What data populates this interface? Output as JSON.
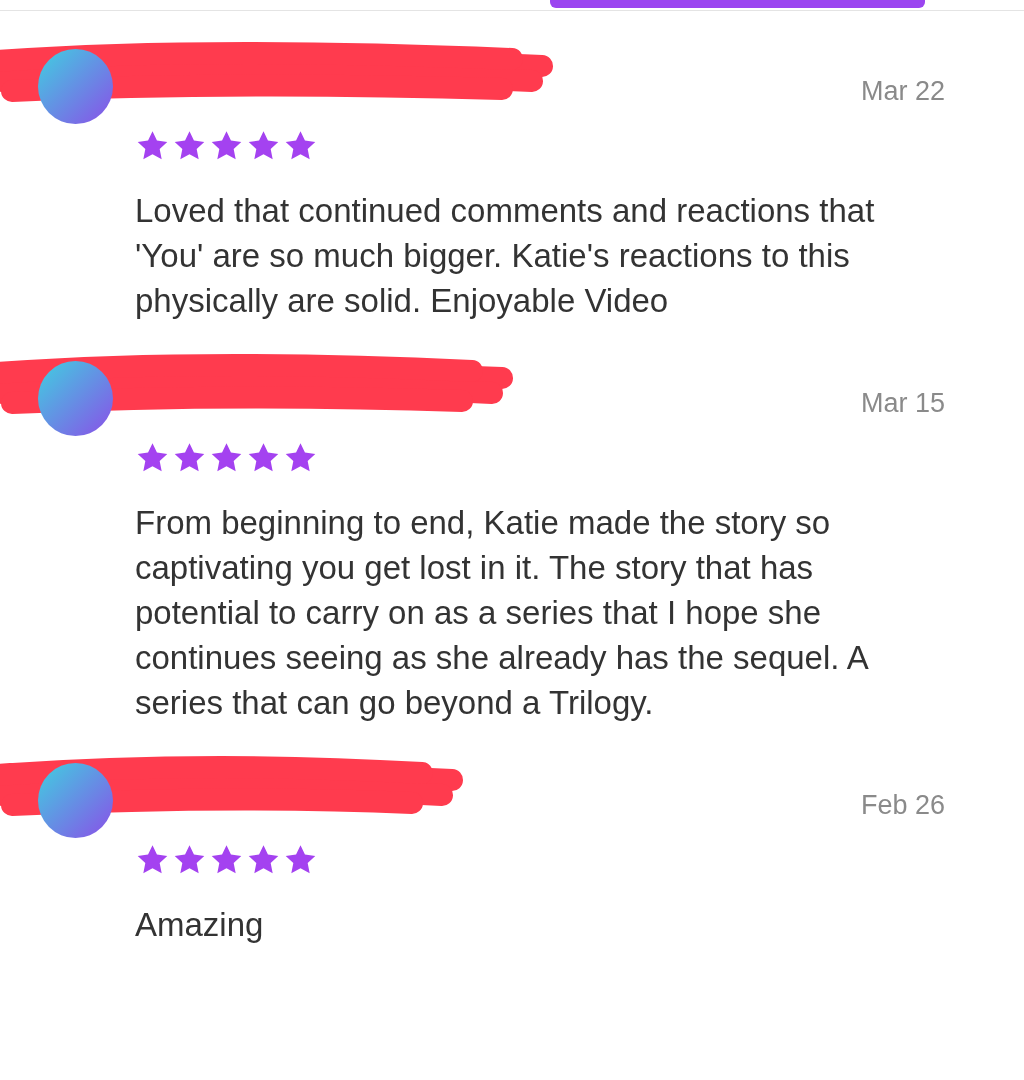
{
  "tab_indicator": {
    "selected": true
  },
  "reviews": [
    {
      "redacted": true,
      "date": "Mar 22",
      "stars": 5,
      "text": "Loved that continued comments and reactions that 'You' are so much bigger. Katie's reactions to this physically are solid. Enjoyable Video"
    },
    {
      "redacted": true,
      "date": "Mar 15",
      "stars": 5,
      "text": "From beginning to end, Katie made the story so captivating you get lost in it. The story that has potential to carry on as a series that I hope she continues seeing as she already has the sequel. A series that can go beyond a Trilogy."
    },
    {
      "redacted": true,
      "date": "Feb 26",
      "stars": 5,
      "text": "Amazing"
    }
  ]
}
